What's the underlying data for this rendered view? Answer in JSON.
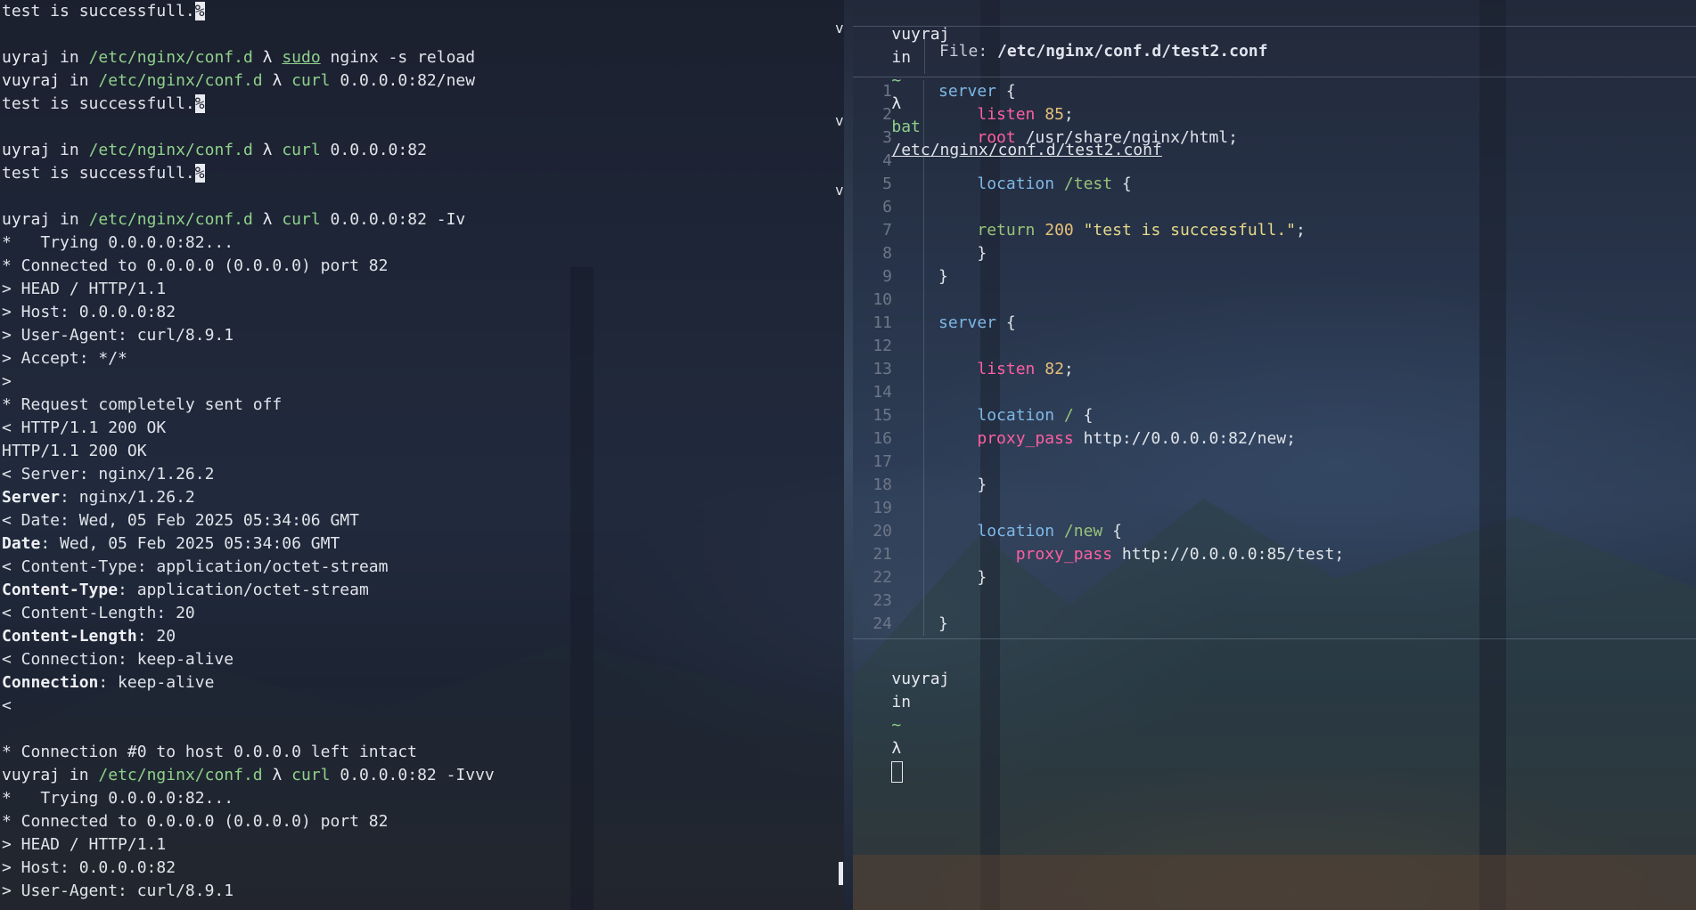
{
  "left_terminal": {
    "lines": [
      {
        "type": "out",
        "text": "test is successfull.",
        "cursor": "%"
      },
      {
        "type": "blank"
      },
      {
        "type": "prompt",
        "user": "uyraj",
        "in": "in",
        "dir": "/etc/nginx/conf.d",
        "lambda": "λ",
        "cmd": "sudo",
        "args": "nginx -s reload",
        "underline": true
      },
      {
        "type": "prompt",
        "user": "vuyraj",
        "in": "in",
        "dir": "/etc/nginx/conf.d",
        "lambda": "λ",
        "cmd": "curl",
        "args": "0.0.0.0:82/new"
      },
      {
        "type": "out",
        "text": "test is successfull.",
        "cursor": "%"
      },
      {
        "type": "blank"
      },
      {
        "type": "prompt",
        "user": "uyraj",
        "in": "in",
        "dir": "/etc/nginx/conf.d",
        "lambda": "λ",
        "cmd": "curl",
        "args": "0.0.0.0:82"
      },
      {
        "type": "out",
        "text": "test is successfull.",
        "cursor": "%"
      },
      {
        "type": "blank"
      },
      {
        "type": "prompt",
        "user": "uyraj",
        "in": "in",
        "dir": "/etc/nginx/conf.d",
        "lambda": "λ",
        "cmd": "curl",
        "args": "0.0.0.0:82 -Iv"
      },
      {
        "type": "out",
        "text": "*   Trying 0.0.0.0:82..."
      },
      {
        "type": "out",
        "text": "* Connected to 0.0.0.0 (0.0.0.0) port 82"
      },
      {
        "type": "out",
        "text": "> HEAD / HTTP/1.1"
      },
      {
        "type": "out",
        "text": "> Host: 0.0.0.0:82"
      },
      {
        "type": "out",
        "text": "> User-Agent: curl/8.9.1"
      },
      {
        "type": "out",
        "text": "> Accept: */*"
      },
      {
        "type": "out",
        "text": ">"
      },
      {
        "type": "out",
        "text": "* Request completely sent off"
      },
      {
        "type": "out",
        "text": "< HTTP/1.1 200 OK"
      },
      {
        "type": "out",
        "text": "HTTP/1.1 200 OK"
      },
      {
        "type": "out",
        "text": "< Server: nginx/1.26.2"
      },
      {
        "type": "hdr",
        "key": "Server",
        "val": ": nginx/1.26.2"
      },
      {
        "type": "out",
        "text": "< Date: Wed, 05 Feb 2025 05:34:06 GMT"
      },
      {
        "type": "hdr",
        "key": "Date",
        "val": ": Wed, 05 Feb 2025 05:34:06 GMT"
      },
      {
        "type": "out",
        "text": "< Content-Type: application/octet-stream"
      },
      {
        "type": "hdr",
        "key": "Content-Type",
        "val": ": application/octet-stream"
      },
      {
        "type": "out",
        "text": "< Content-Length: 20"
      },
      {
        "type": "hdr",
        "key": "Content-Length",
        "val": ": 20"
      },
      {
        "type": "out",
        "text": "< Connection: keep-alive"
      },
      {
        "type": "hdr",
        "key": "Connection",
        "val": ": keep-alive"
      },
      {
        "type": "out",
        "text": "<"
      },
      {
        "type": "blank"
      },
      {
        "type": "out",
        "text": "* Connection #0 to host 0.0.0.0 left intact"
      },
      {
        "type": "prompt",
        "user": "vuyraj",
        "in": "in",
        "dir": "/etc/nginx/conf.d",
        "lambda": "λ",
        "cmd": "curl",
        "args": "0.0.0.0:82 -Ivvv"
      },
      {
        "type": "out",
        "text": "*   Trying 0.0.0.0:82..."
      },
      {
        "type": "out",
        "text": "* Connected to 0.0.0.0 (0.0.0.0) port 82"
      },
      {
        "type": "out",
        "text": "> HEAD / HTTP/1.1"
      },
      {
        "type": "out",
        "text": "> Host: 0.0.0.0:82"
      },
      {
        "type": "out",
        "text": "> User-Agent: curl/8.9.1"
      }
    ],
    "markers": [
      "v",
      "v",
      "v"
    ]
  },
  "right_terminal": {
    "top_prompt": {
      "user": "vuyraj",
      "in": "in",
      "dir": "~",
      "lambda": "λ",
      "cmd": "bat",
      "args": "/etc/nginx/conf.d/test2.conf"
    },
    "file_label": "File:",
    "file_path": "/etc/nginx/conf.d/test2.conf",
    "code_lines": [
      {
        "n": "1",
        "tokens": [
          [
            "kw",
            "server"
          ],
          [
            "txt",
            " {"
          ]
        ]
      },
      {
        "n": "2",
        "tokens": [
          [
            "txt",
            "    "
          ],
          [
            "dir2",
            "listen"
          ],
          [
            "txt",
            " "
          ],
          [
            "num",
            "85"
          ],
          [
            "txt",
            ";"
          ]
        ]
      },
      {
        "n": "3",
        "tokens": [
          [
            "txt",
            "    "
          ],
          [
            "dir2",
            "root"
          ],
          [
            "txt",
            " /usr/share/nginx/html;"
          ]
        ]
      },
      {
        "n": "4",
        "tokens": []
      },
      {
        "n": "5",
        "tokens": [
          [
            "txt",
            "    "
          ],
          [
            "kw",
            "location"
          ],
          [
            "txt",
            " "
          ],
          [
            "uri",
            "/test"
          ],
          [
            "txt",
            " {"
          ]
        ]
      },
      {
        "n": "6",
        "tokens": []
      },
      {
        "n": "7",
        "tokens": [
          [
            "txt",
            "    "
          ],
          [
            "uri",
            "return"
          ],
          [
            "txt",
            " "
          ],
          [
            "num",
            "200"
          ],
          [
            "txt",
            " "
          ],
          [
            "str",
            "\"test is successfull.\""
          ],
          [
            "txt",
            ";"
          ]
        ]
      },
      {
        "n": "8",
        "tokens": [
          [
            "txt",
            "    }"
          ]
        ]
      },
      {
        "n": "9",
        "tokens": [
          [
            "txt",
            "}"
          ]
        ]
      },
      {
        "n": "10",
        "tokens": []
      },
      {
        "n": "11",
        "tokens": [
          [
            "kw",
            "server"
          ],
          [
            "txt",
            " {"
          ]
        ]
      },
      {
        "n": "12",
        "tokens": []
      },
      {
        "n": "13",
        "tokens": [
          [
            "txt",
            "    "
          ],
          [
            "dir2",
            "listen"
          ],
          [
            "txt",
            " "
          ],
          [
            "num",
            "82"
          ],
          [
            "txt",
            ";"
          ]
        ]
      },
      {
        "n": "14",
        "tokens": []
      },
      {
        "n": "15",
        "tokens": [
          [
            "txt",
            "    "
          ],
          [
            "kw",
            "location"
          ],
          [
            "txt",
            " "
          ],
          [
            "uri",
            "/"
          ],
          [
            "txt",
            " {"
          ]
        ]
      },
      {
        "n": "16",
        "tokens": [
          [
            "txt",
            "    "
          ],
          [
            "dir2",
            "proxy_pass"
          ],
          [
            "txt",
            " http://0.0.0.0:82/new;"
          ]
        ]
      },
      {
        "n": "17",
        "tokens": []
      },
      {
        "n": "18",
        "tokens": [
          [
            "txt",
            "    }"
          ]
        ]
      },
      {
        "n": "19",
        "tokens": []
      },
      {
        "n": "20",
        "tokens": [
          [
            "txt",
            "    "
          ],
          [
            "kw",
            "location"
          ],
          [
            "txt",
            " "
          ],
          [
            "uri",
            "/new"
          ],
          [
            "txt",
            " {"
          ]
        ]
      },
      {
        "n": "21",
        "tokens": [
          [
            "txt",
            "        "
          ],
          [
            "dir2",
            "proxy_pass"
          ],
          [
            "txt",
            " http://0.0.0.0:85/test;"
          ]
        ]
      },
      {
        "n": "22",
        "tokens": [
          [
            "txt",
            "    }"
          ]
        ]
      },
      {
        "n": "23",
        "tokens": []
      },
      {
        "n": "24",
        "tokens": [
          [
            "txt",
            "}"
          ]
        ]
      }
    ],
    "bottom_prompt": {
      "user": "vuyraj",
      "in": "in",
      "dir": "~",
      "lambda": "λ"
    }
  }
}
